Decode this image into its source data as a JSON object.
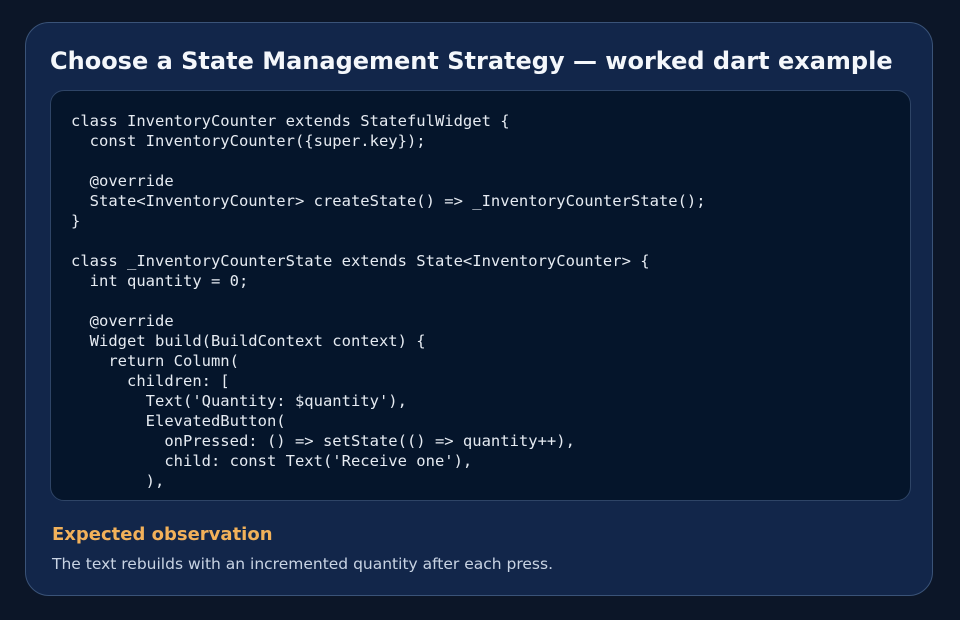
{
  "header": {
    "title": "Choose a State Management Strategy — worked dart example"
  },
  "code_block": {
    "language": "dart",
    "lines": [
      "class InventoryCounter extends StatefulWidget {",
      "  const InventoryCounter({super.key});",
      "",
      "  @override",
      "  State<InventoryCounter> createState() => _InventoryCounterState();",
      "}",
      "",
      "class _InventoryCounterState extends State<InventoryCounter> {",
      "  int quantity = 0;",
      "",
      "  @override",
      "  Widget build(BuildContext context) {",
      "    return Column(",
      "      children: [",
      "        Text('Quantity: $quantity'),",
      "        ElevatedButton(",
      "          onPressed: () => setState(() => quantity++),",
      "          child: const Text('Receive one'),",
      "        ),"
    ]
  },
  "observation": {
    "heading": "Expected observation",
    "text": "The text rebuilds with an incremented quantity after each press."
  }
}
